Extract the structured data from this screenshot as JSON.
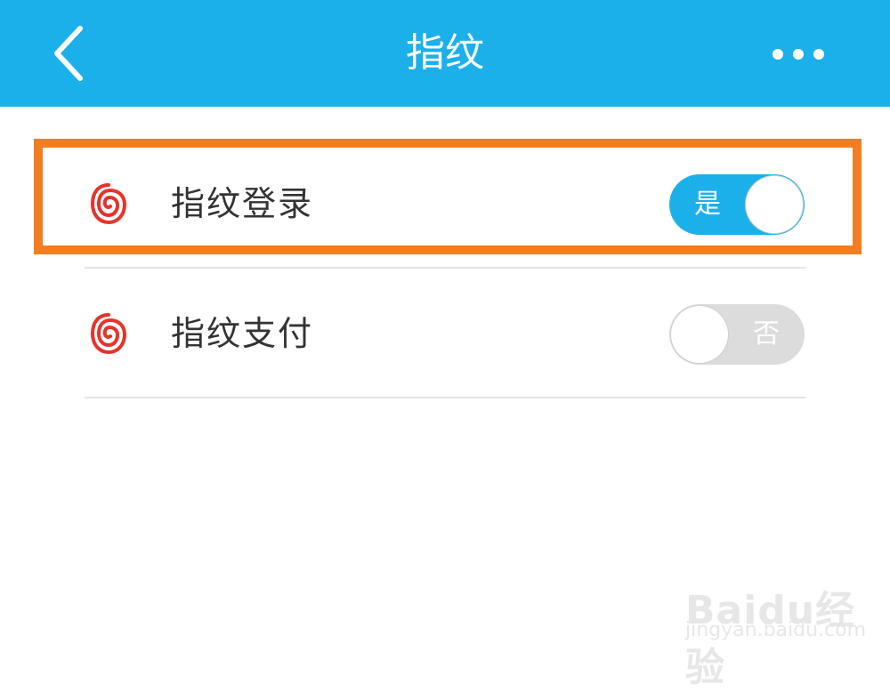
{
  "header": {
    "title": "指纹",
    "back_icon": "chevron-left-icon",
    "more_icon": "more-dots-icon",
    "color": "#1cb0ea"
  },
  "settings": [
    {
      "label": "指纹登录",
      "icon": "fingerprint-icon",
      "toggle_state": "on",
      "toggle_text": "是"
    },
    {
      "label": "指纹支付",
      "icon": "fingerprint-icon",
      "toggle_state": "off",
      "toggle_text": "否"
    }
  ],
  "highlight": {
    "color": "#f47d20",
    "target": "指纹登录"
  },
  "watermark": {
    "brand": "Baidu经验",
    "url": "jingyan.baidu.com"
  },
  "colors": {
    "accent": "#1cb0ea",
    "icon_red": "#e5342b",
    "toggle_off": "#dcdcdc"
  }
}
